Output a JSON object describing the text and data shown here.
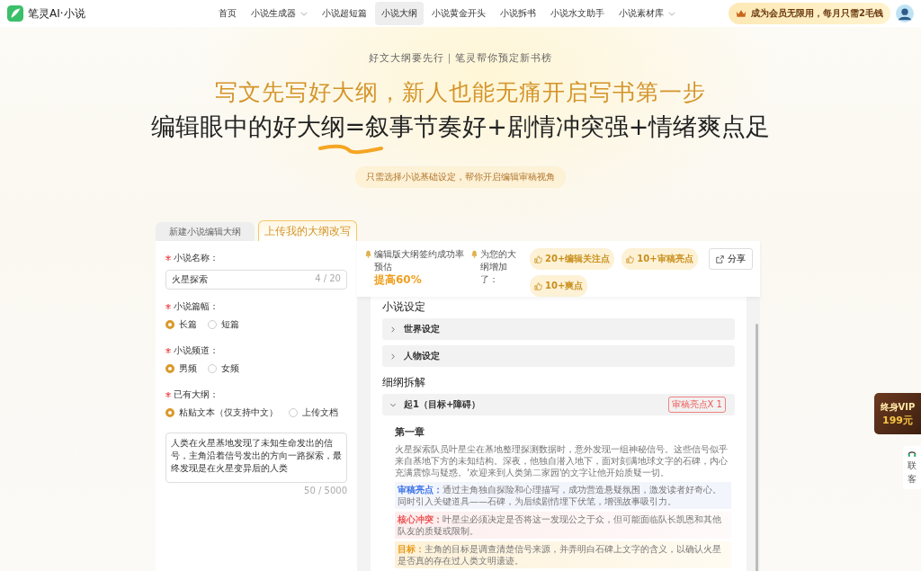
{
  "nav": {
    "logo": "笔灵AI·小说",
    "items": [
      {
        "label": "首页",
        "dropdown": false,
        "selected": false
      },
      {
        "label": "小说生成器",
        "dropdown": true,
        "selected": false
      },
      {
        "label": "小说超短篇",
        "dropdown": false,
        "selected": false
      },
      {
        "label": "小说大纲",
        "dropdown": false,
        "selected": true
      },
      {
        "label": "小说黄金开头",
        "dropdown": false,
        "selected": false
      },
      {
        "label": "小说拆书",
        "dropdown": false,
        "selected": false
      },
      {
        "label": "小说水文助手",
        "dropdown": false,
        "selected": false
      },
      {
        "label": "小说素材库",
        "dropdown": true,
        "selected": false
      }
    ],
    "promo": "成为会员无限用，每月只需2毛钱"
  },
  "hero": {
    "tagline": "好文大纲要先行｜笔灵帮你预定新书榜",
    "headline": "写文先写好大纲，新人也能无痛开启写书第一步",
    "subheadline": "编辑眼中的好大纲=叙事节奏好+剧情冲突强+情绪爽点足",
    "hint": "只需选择小说基础设定，帮你开启编辑审稿视角"
  },
  "tabs": [
    {
      "label": "新建小说编辑大纲",
      "selected": false
    },
    {
      "label": "上传我的大纲改写",
      "selected": true
    }
  ],
  "form": [
    {
      "kind": "text",
      "label": "小说名称：",
      "required": true,
      "value": "火星探索",
      "counter": "4 / 20"
    },
    {
      "kind": "radio",
      "label": "小说篇幅：",
      "required": true,
      "options": [
        {
          "label": "长篇",
          "selected": true
        },
        {
          "label": "短篇",
          "selected": false
        }
      ]
    },
    {
      "kind": "radio",
      "label": "小说频道：",
      "required": true,
      "options": [
        {
          "label": "男频",
          "selected": true
        },
        {
          "label": "女频",
          "selected": false
        }
      ]
    },
    {
      "kind": "radio",
      "label": "已有大纲：",
      "required": true,
      "options": [
        {
          "label": "粘贴文本（仅支持中文）",
          "selected": true
        },
        {
          "label": "上传文档",
          "selected": false
        }
      ]
    },
    {
      "kind": "textarea",
      "value": "人类在火星基地发现了未知生命发出的信号，主角沿着信号发出的方向一路探索，最终发现是在火星变异后的人类",
      "counter": "50 / 5000"
    }
  ],
  "result": {
    "rate_text": "编辑版大纲签约成功率预估",
    "rate_highlight": "提高60%",
    "added_label": "为您的大纲增加了：",
    "tags": [
      "20+编辑关注点",
      "10+审稿亮点",
      "10+爽点"
    ],
    "share": "分享",
    "sections": [
      {
        "title": "小说设定",
        "items": [
          {
            "label": "世界设定",
            "expanded": false
          },
          {
            "label": "人物设定",
            "expanded": false
          }
        ]
      },
      {
        "title": "细纲拆解",
        "items": [
          {
            "label": "起1（目标+障碍）",
            "expanded": true,
            "badge": "审稿亮点X 1",
            "chapter": "第一章",
            "body": "火星探索队员叶星尘在基地整理探测数据时，意外发现一组神秘信号。这些信号似乎来自基地下方的未知结构。深夜，他独自潜入地下，面对刻满地球文字的石碑，内心充满震惊与疑惑。'欢迎来到人类第二家园'的文字让他开始质疑一切。",
            "notes": [
              {
                "kind": "highlight",
                "label": "审稿亮点：",
                "text": "通过主角独自探险和心理描写，成功营造悬疑氛围，激发读者好奇心。同时引入关键道具——石碑，为后续剧情埋下伏笔，增强故事吸引力。"
              },
              {
                "kind": "conflict",
                "label": "核心冲突：",
                "text": "叶星尘必须决定是否将这一发现公之于众，但可能面临队长凯恩和其他队友的质疑或限制。"
              },
              {
                "kind": "goal",
                "label": "目标：",
                "text": "主角的目标是调查清楚信号来源，并弄明白石碑上文字的含义，以确认火星是否真的存在过人类文明遗迹。"
              }
            ]
          }
        ]
      }
    ]
  },
  "side": {
    "vip_line1": "终身VIP",
    "vip_line2": "199元",
    "contact_line1": "联",
    "contact_line2": "客"
  }
}
